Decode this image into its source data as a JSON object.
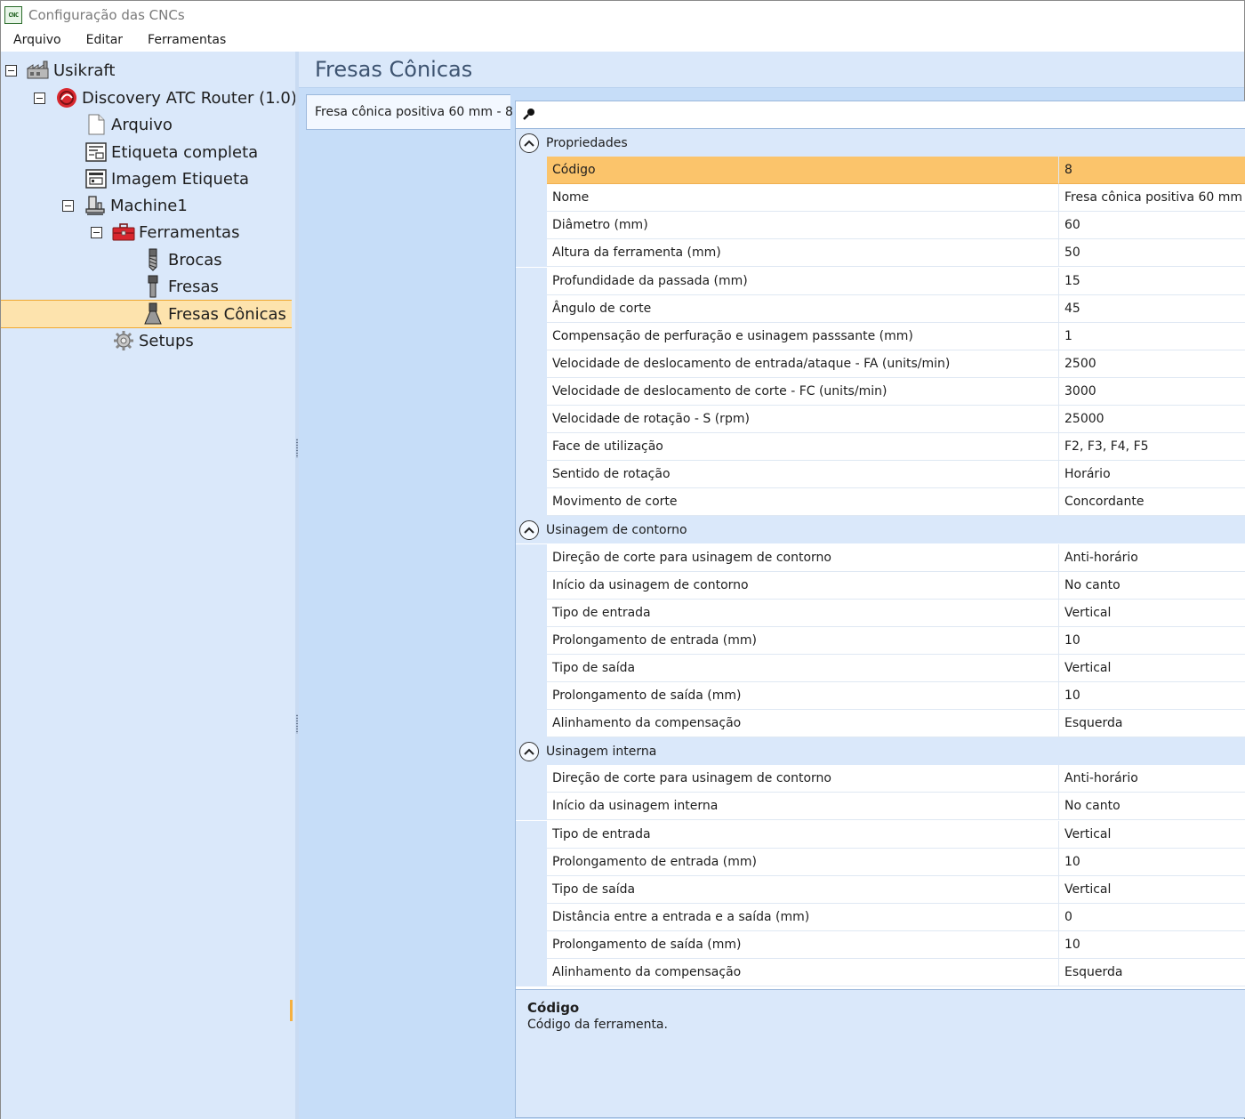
{
  "window": {
    "title": "Configuração das CNCs",
    "app_icon_text": "CNC"
  },
  "menu": {
    "items": [
      "Arquivo",
      "Editar",
      "Ferramentas"
    ]
  },
  "tree": {
    "nodes": [
      {
        "label": "Usikraft",
        "icon": "factory-icon",
        "expanded": true
      },
      {
        "label": "Discovery ATC Router (1.0)",
        "icon": "router-logo-icon",
        "expanded": true
      },
      {
        "label": "Arquivo",
        "icon": "document-icon"
      },
      {
        "label": "Etiqueta completa",
        "icon": "label-icon"
      },
      {
        "label": "Imagem Etiqueta",
        "icon": "label-image-icon"
      },
      {
        "label": "Machine1",
        "icon": "machine-icon",
        "expanded": true
      },
      {
        "label": "Ferramentas",
        "icon": "toolbox-icon",
        "expanded": true
      },
      {
        "label": "Brocas",
        "icon": "drill-bit-icon"
      },
      {
        "label": "Fresas",
        "icon": "mill-bit-icon"
      },
      {
        "label": "Fresas Cônicas",
        "icon": "conical-mill-icon",
        "selected": true
      },
      {
        "label": "Setups",
        "icon": "gear-icon"
      }
    ]
  },
  "main": {
    "title": "Fresas Cônicas",
    "tab_label": "Fresa cônica positiva 60 mm - 8"
  },
  "grid": {
    "search_icon": "search-icon",
    "categories": [
      {
        "name": "Propriedades",
        "rows": [
          {
            "name": "Código",
            "value": "8",
            "selected": true
          },
          {
            "name": "Nome",
            "value": "Fresa cônica positiva 60 mm"
          },
          {
            "name": "Diâmetro (mm)",
            "value": "60"
          },
          {
            "name": "Altura da ferramenta (mm)",
            "value": "50"
          },
          {
            "name": "Profundidade da passada (mm)",
            "value": "15"
          },
          {
            "name": "Ângulo de corte",
            "value": "45"
          },
          {
            "name": "Compensação de perfuração e usinagem passsante (mm)",
            "value": "1"
          },
          {
            "name": "Velocidade de deslocamento de entrada/ataque - FA (units/min)",
            "value": "2500"
          },
          {
            "name": "Velocidade de deslocamento de corte - FC (units/min)",
            "value": "3000"
          },
          {
            "name": "Velocidade de rotação - S (rpm)",
            "value": "25000"
          },
          {
            "name": "Face de utilização",
            "value": "F2, F3, F4, F5"
          },
          {
            "name": "Sentido de rotação",
            "value": "Horário"
          },
          {
            "name": "Movimento de corte",
            "value": "Concordante"
          }
        ]
      },
      {
        "name": "Usinagem de contorno",
        "rows": [
          {
            "name": "Direção de corte para usinagem de contorno",
            "value": "Anti-horário"
          },
          {
            "name": "Início da usinagem de contorno",
            "value": "No canto"
          },
          {
            "name": "Tipo de entrada",
            "value": "Vertical"
          },
          {
            "name": "Prolongamento de entrada (mm)",
            "value": "10"
          },
          {
            "name": "Tipo de saída",
            "value": "Vertical"
          },
          {
            "name": "Prolongamento de saída (mm)",
            "value": "10"
          },
          {
            "name": "Alinhamento da compensação",
            "value": "Esquerda"
          }
        ]
      },
      {
        "name": "Usinagem interna",
        "rows": [
          {
            "name": "Direção de corte para usinagem de contorno",
            "value": "Anti-horário"
          },
          {
            "name": "Início da usinagem interna",
            "value": "No canto"
          },
          {
            "name": "Tipo de entrada",
            "value": "Vertical"
          },
          {
            "name": "Prolongamento de entrada (mm)",
            "value": "10"
          },
          {
            "name": "Tipo de saída",
            "value": "Vertical"
          },
          {
            "name": "Distância entre a entrada e a saída (mm)",
            "value": "0"
          },
          {
            "name": "Prolongamento de saída (mm)",
            "value": "10"
          },
          {
            "name": "Alinhamento da compensação",
            "value": "Esquerda"
          }
        ]
      }
    ]
  },
  "description": {
    "title": "Código",
    "text": "Código da ferramenta."
  },
  "colors": {
    "pane_bg": "#dae8fa",
    "selection": "#fbc46b",
    "accent_orange": "#f0a830"
  }
}
